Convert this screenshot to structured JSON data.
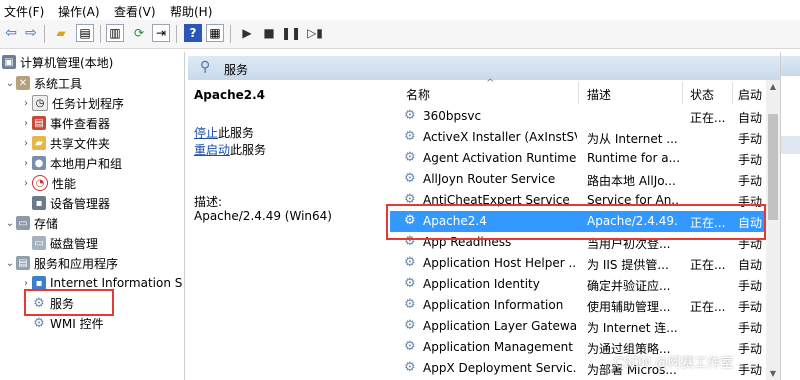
{
  "menu": [
    "文件(F)",
    "操作(A)",
    "查看(V)",
    "帮助(H)"
  ],
  "tree": {
    "root": "计算机管理(本地)",
    "system_tools": "系统工具",
    "task_scheduler": "任务计划程序",
    "event_viewer": "事件查看器",
    "shared_folders": "共享文件夹",
    "local_users": "本地用户和组",
    "performance": "性能",
    "device_manager": "设备管理器",
    "storage": "存储",
    "disk_management": "磁盘管理",
    "services_apps": "服务和应用程序",
    "iis": "Internet Information S",
    "services": "服务",
    "wmi": "WMI 控件"
  },
  "panel": {
    "title": "服务"
  },
  "detail": {
    "service_name": "Apache2.4",
    "stop_link": "停止",
    "stop_suffix": "此服务",
    "restart_link": "重启动",
    "restart_suffix": "此服务",
    "desc_label": "描述:",
    "desc_value": "Apache/2.4.49 (Win64)"
  },
  "columns": {
    "name": "名称",
    "desc": "描述",
    "status": "状态",
    "startup": "启动"
  },
  "rows": [
    {
      "name": "360bpsvc",
      "desc": "",
      "status": "正在...",
      "startup": "自动"
    },
    {
      "name": "ActiveX Installer (AxInstSV)",
      "desc": "为从 Internet ...",
      "status": "",
      "startup": "手动"
    },
    {
      "name": "Agent Activation Runtime...",
      "desc": "Runtime for a...",
      "status": "",
      "startup": "手动"
    },
    {
      "name": "AllJoyn Router Service",
      "desc": "路由本地 AllJo...",
      "status": "",
      "startup": "手动"
    },
    {
      "name": "AntiCheatExpert Service",
      "desc": "Service for An...",
      "status": "",
      "startup": "手动"
    },
    {
      "name": "Apache2.4",
      "desc": "Apache/2.4.49...",
      "status": "正在...",
      "startup": "自动"
    },
    {
      "name": "App Readiness",
      "desc": "当用户初次登...",
      "status": "",
      "startup": "手动"
    },
    {
      "name": "Application Host Helper ...",
      "desc": "为 IIS 提供管...",
      "status": "正在...",
      "startup": "自动"
    },
    {
      "name": "Application Identity",
      "desc": "确定并验证应...",
      "status": "",
      "startup": "手动"
    },
    {
      "name": "Application Information",
      "desc": "使用辅助管理...",
      "status": "正在...",
      "startup": "手动"
    },
    {
      "name": "Application Layer Gatewa...",
      "desc": "为 Internet 连...",
      "status": "",
      "startup": "手动"
    },
    {
      "name": "Application Management",
      "desc": "为通过组策略...",
      "status": "",
      "startup": "手动"
    },
    {
      "name": "AppX Deployment Servic...",
      "desc": "为部署 Micros...",
      "status": "",
      "startup": "手动"
    }
  ],
  "selected_row": "Apache2.4",
  "watermark": "CSDN @阿赛工作室",
  "colors": {
    "selection": "#3399ff",
    "highlight_box": "#e53935",
    "header_bg": "#c9d9ea"
  }
}
